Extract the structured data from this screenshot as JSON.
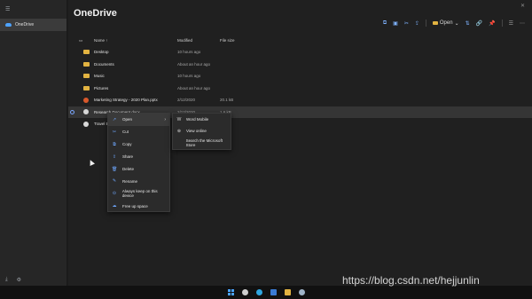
{
  "window": {
    "title": "OneDrive",
    "close_glyph": "✕"
  },
  "sidebar": {
    "menu_glyph": "☰",
    "items": [
      {
        "label": "OneDrive",
        "icon": "cloud-icon",
        "selected": true
      }
    ],
    "bottom_icons": [
      "download-icon",
      "settings-icon"
    ]
  },
  "toolbar": {
    "open_label": "Open",
    "icons": [
      "copy-icon",
      "paste-icon",
      "cut-icon",
      "share-icon",
      "folder-icon",
      "sort-icon",
      "link-icon",
      "pin-icon",
      "view-icon",
      "more-icon"
    ]
  },
  "columns": {
    "name": "Name ↑",
    "modified": "Modified",
    "size": "File size"
  },
  "files": [
    {
      "name": "Desktop",
      "type": "folder",
      "modified": "10 hours ago",
      "size": ""
    },
    {
      "name": "Documents",
      "type": "folder",
      "modified": "About an hour ago",
      "size": ""
    },
    {
      "name": "Music",
      "type": "folder",
      "modified": "10 hours ago",
      "size": ""
    },
    {
      "name": "Pictures",
      "type": "folder",
      "modified": "About an hour ago",
      "size": ""
    },
    {
      "name": "Marketing Strategy - 2020 Plan.pptx",
      "type": "ppt",
      "modified": "2/12/2020",
      "size": "20.1 kB"
    },
    {
      "name": "Research Document.docx",
      "type": "doc",
      "modified": "2/12/2020",
      "size": "1.6 kB",
      "selected": true
    },
    {
      "name": "Travel Expenses.docx",
      "type": "doc",
      "modified": "",
      "size": ""
    }
  ],
  "context_menu": {
    "items": [
      {
        "label": "Open",
        "icon": "open-icon",
        "glyph": "↗",
        "submenu": true
      },
      {
        "label": "Cut",
        "icon": "cut-icon",
        "glyph": "✂"
      },
      {
        "label": "Copy",
        "icon": "copy-icon",
        "glyph": "⧉"
      },
      {
        "label": "Share",
        "icon": "share-icon",
        "glyph": "⇪"
      },
      {
        "label": "Delete",
        "icon": "delete-icon",
        "glyph": "🗑"
      },
      {
        "label": "Rename",
        "icon": "rename-icon",
        "glyph": "✎"
      },
      {
        "label": "Always keep on this device",
        "icon": "pin-icon",
        "glyph": "⊙"
      },
      {
        "label": "Free up space",
        "icon": "cloud-icon",
        "glyph": "☁"
      }
    ],
    "submenu_arrow": "›"
  },
  "open_submenu": {
    "items": [
      {
        "label": "Word Mobile",
        "icon": "word-icon",
        "glyph": "W"
      },
      {
        "label": "View online",
        "icon": "globe-icon",
        "glyph": "⊕"
      },
      {
        "label": "Search the Microsoft Store",
        "icon": "store-icon",
        "glyph": ""
      }
    ]
  },
  "taskbar": {
    "icons": [
      "windows-start-icon",
      "search-icon",
      "edge-icon",
      "store-icon",
      "explorer-icon",
      "onedrive-icon"
    ]
  },
  "watermark": "https://blog.csdn.net/hejjunlin",
  "colors": {
    "accent": "#4aa3ff",
    "folder": "#e2b341",
    "background": "#202020",
    "sidebar": "#262626"
  }
}
